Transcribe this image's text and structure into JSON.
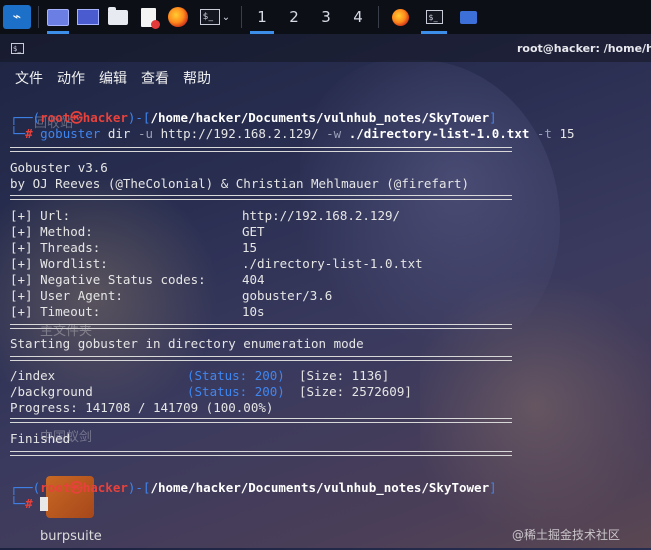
{
  "taskbar": {
    "workspaces": [
      "1",
      "2",
      "3",
      "4"
    ]
  },
  "window": {
    "title": "root@hacker: /home/har"
  },
  "menu": {
    "items": [
      "文件",
      "动作",
      "编辑",
      "查看",
      "帮助"
    ]
  },
  "terminal": {
    "prompt1": {
      "user_host": "root㉿hacker",
      "path": "/home/hacker/Documents/vulnhub_notes/SkyTower",
      "symbol": "#",
      "cmd": "gobuster",
      "sub": "dir",
      "flag_u": "-u",
      "url": "http://192.168.2.129/",
      "flag_w": "-w",
      "wordlist": "./directory-list-1.0.txt",
      "flag_t": "-t",
      "threads": "15"
    },
    "banner": [
      "Gobuster v3.6",
      "by OJ Reeves (@TheColonial) & Christian Mehlmauer (@firefart)"
    ],
    "config": [
      {
        "key": "[+] Url:",
        "value": "http://192.168.2.129/"
      },
      {
        "key": "[+] Method:",
        "value": "GET"
      },
      {
        "key": "[+] Threads:",
        "value": "15"
      },
      {
        "key": "[+] Wordlist:",
        "value": "./directory-list-1.0.txt"
      },
      {
        "key": "[+] Negative Status codes:",
        "value": "404"
      },
      {
        "key": "[+] User Agent:",
        "value": "gobuster/3.6"
      },
      {
        "key": "[+] Timeout:",
        "value": "10s"
      }
    ],
    "starting": "Starting gobuster in directory enumeration mode",
    "results": [
      {
        "path": "/index",
        "status_label": "(Status: 200)",
        "size": "[Size: 1136]"
      },
      {
        "path": "/background",
        "status_label": "(Status: 200)",
        "size": "[Size: 2572609]"
      }
    ],
    "progress": "Progress: 141708 / 141709 (100.00%)",
    "finished": "Finished",
    "prompt2": {
      "user_host": "root㉿hacker",
      "path": "/home/hacker/Documents/vulnhub_notes/SkyTower",
      "symbol": "#"
    }
  },
  "desktop": {
    "burp_label": "burpsuite",
    "faded": [
      "回收站",
      "主文件夹",
      "中国蚁剑"
    ]
  },
  "watermark": "@稀土掘金技术社区"
}
